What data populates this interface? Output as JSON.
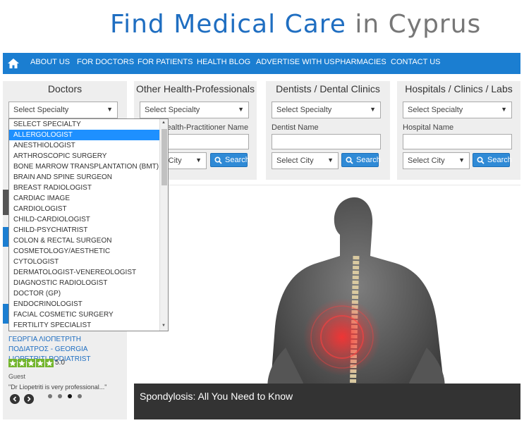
{
  "logo": {
    "part1": "Find Medical Care",
    "part2": "in Cyprus"
  },
  "nav": {
    "home_icon": "home-icon",
    "items": [
      "ABOUT US",
      "FOR DOCTORS",
      "FOR PATIENTS",
      "HEALTH BLOG",
      "ADVERTISE WITH US",
      "PHARMACIES",
      "CONTACT US"
    ]
  },
  "panels": {
    "doctors": {
      "title": "Doctors",
      "specialty": "Select Specialty"
    },
    "other": {
      "title": "Other Health-Professionals",
      "specialty": "Select Specialty",
      "name_label": "Other Health-Practitioner Name",
      "city": "Select City",
      "search": "Search"
    },
    "dentists": {
      "title": "Dentists / Dental Clinics",
      "specialty": "Select Specialty",
      "name_label": "Dentist Name",
      "city": "Select City",
      "search": "Search"
    },
    "hospitals": {
      "title": "Hospitals / Clinics / Labs",
      "specialty": "Select Specialty",
      "name_label": "Hospital Name",
      "city": "Select City",
      "search": "Search"
    }
  },
  "dropdown": {
    "selected_index": 1,
    "options": [
      "SELECT SPECIALTY",
      "ALLERGOLOGIST",
      "ANESTHIOLOGIST",
      "ARTHROSCOPIC SURGERY",
      "BONE MARROW TRANSPLANTATION (BMT)",
      "BRAIN AND SPINE SURGEON",
      "BREAST RADIOLOGIST",
      "CARDIAC IMAGE",
      "CARDIOLOGIST",
      "CHILD-CARDIOLOGIST",
      "CHILD-PSYCHIATRIST",
      "COLON & RECTAL SURGEON",
      "COSMETOLOGY/AESTHETIC",
      "CYTOLOGIST",
      "DERMATOLOGIST-VENEREOLOGIST",
      "DIAGNOSTIC RADIOLOGIST",
      "DOCTOR (GP)",
      "ENDOCRINOLOGIST",
      "FACIAL COSMETIC SURGERY",
      "FERTILITY SPECIALIST"
    ]
  },
  "review": {
    "title": "ΓΕΩΡΓΙΑ ΛΙΟΠΕΤΡΙΤΗ ΠΟΔΙΑΤΡΟΣ - GEORGIA LIOPETRITI PODIATRIST",
    "rating": "5.0",
    "reviewer": "Guest",
    "quote": "\"Dr Liopetriti is very professional...\""
  },
  "hero": {
    "caption": "Spondylosis: All You Need to Know"
  },
  "colors": {
    "brand_blue": "#1b7ed1",
    "panel_bg": "#eeeeee",
    "star_green": "#73b52d",
    "highlight": "#1e90ff"
  }
}
